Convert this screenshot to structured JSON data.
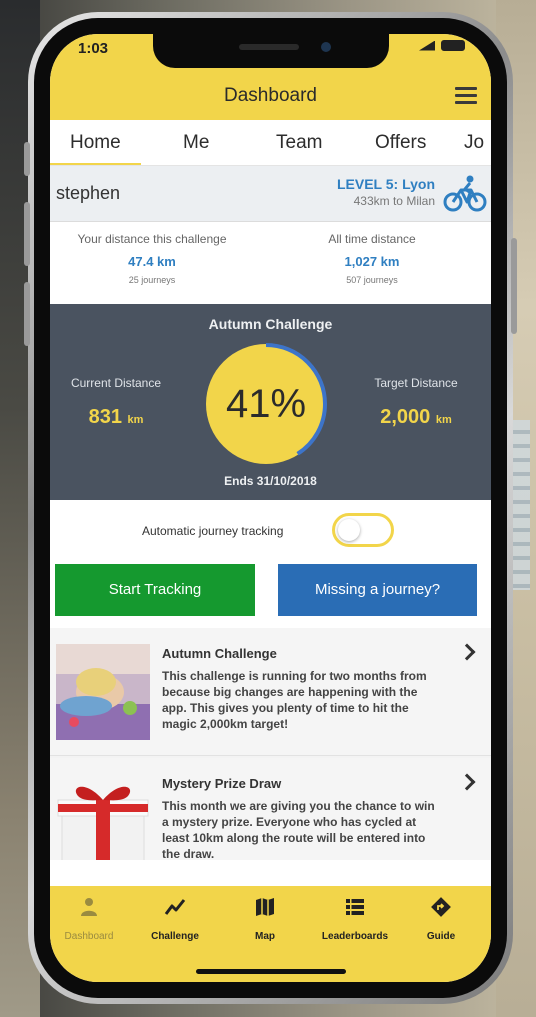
{
  "status": {
    "time": "1:03"
  },
  "header": {
    "title": "Dashboard"
  },
  "tabs": [
    {
      "label": "Home",
      "active": true
    },
    {
      "label": "Me"
    },
    {
      "label": "Team"
    },
    {
      "label": "Offers"
    },
    {
      "label": "Jo"
    }
  ],
  "user": {
    "name": "stephen",
    "level_title": "LEVEL 5: Lyon",
    "level_sub": "433km to Milan"
  },
  "stats": {
    "challenge": {
      "label": "Your distance this challenge",
      "value": "47.4 km",
      "sub": "25 journeys"
    },
    "all_time": {
      "label": "All time distance",
      "value": "1,027 km",
      "sub": "507 journeys"
    }
  },
  "challenge": {
    "title": "Autumn Challenge",
    "current_label": "Current Distance",
    "current_value": "831",
    "current_unit": "km",
    "target_label": "Target Distance",
    "target_value": "2,000",
    "target_unit": "km",
    "percent": "41%",
    "progress": 0.41,
    "ends": "Ends 31/10/2018"
  },
  "tracking": {
    "label": "Automatic journey tracking",
    "enabled": false
  },
  "actions": {
    "start": "Start Tracking",
    "missing": "Missing a journey?"
  },
  "feed": [
    {
      "title": "Autumn Challenge",
      "text": "This challenge is running for two months from because big changes are happening with the app. This gives you plenty of time to hit the magic 2,000km target!"
    },
    {
      "title": "Mystery Prize Draw",
      "text": "This month we are giving you the chance to win a mystery prize. Everyone who has cycled at least 10km along the route will be entered into the draw."
    }
  ],
  "bottom_nav": [
    {
      "label": "Dashboard",
      "icon": "person-icon"
    },
    {
      "label": "Challenge",
      "icon": "trend-icon"
    },
    {
      "label": "Map",
      "icon": "map-icon"
    },
    {
      "label": "Leaderboards",
      "icon": "list-icon"
    },
    {
      "label": "Guide",
      "icon": "directions-icon"
    }
  ],
  "colors": {
    "brand_yellow": "#f2d54a",
    "accent_blue": "#2f7fc1",
    "panel_dark": "#4a5360",
    "green": "#15992f",
    "blue_button": "#2a6db5"
  }
}
